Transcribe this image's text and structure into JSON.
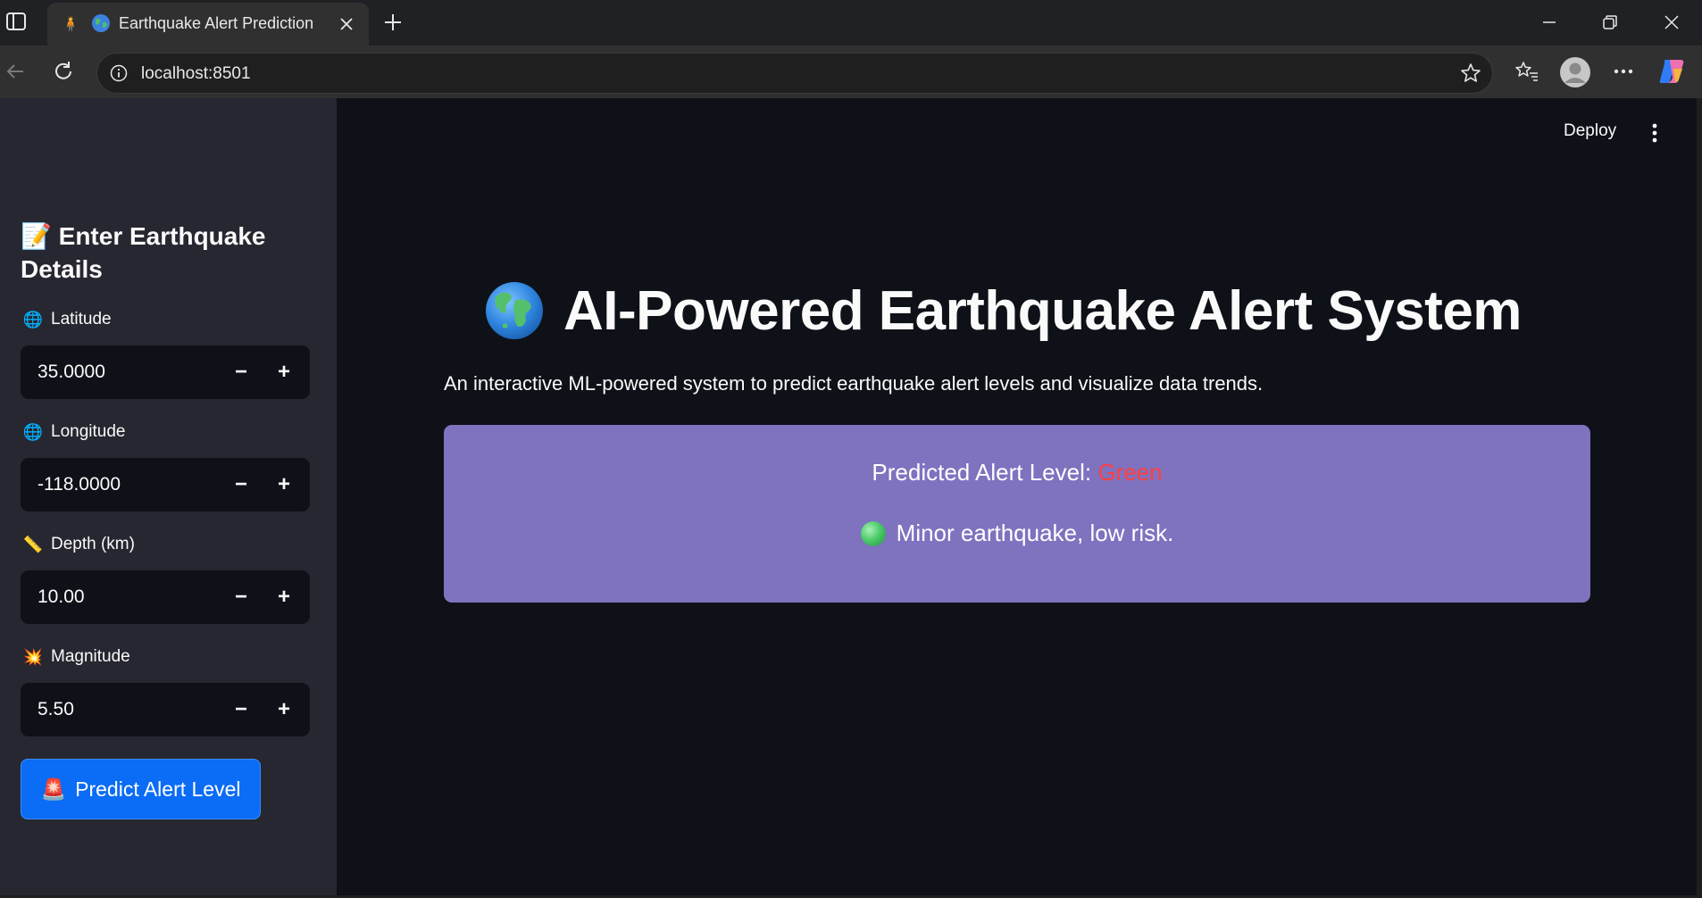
{
  "browser": {
    "tab_title": "Earthquake Alert Prediction",
    "url": "localhost:8501"
  },
  "header": {
    "deploy_label": "Deploy"
  },
  "sidebar": {
    "heading": "📝 Enter Earthquake Details",
    "fields": [
      {
        "icon": "🌐",
        "label": "Latitude",
        "value": "35.0000"
      },
      {
        "icon": "🌐",
        "label": "Longitude",
        "value": "-118.0000"
      },
      {
        "icon": "📏",
        "label": "Depth (km)",
        "value": "10.00"
      },
      {
        "icon": "💥",
        "label": "Magnitude",
        "value": "5.50"
      }
    ],
    "stepper": {
      "minus": "−",
      "plus": "+"
    },
    "predict_button": {
      "icon": "🚨",
      "label": "Predict Alert Level"
    }
  },
  "main": {
    "title": "AI-Powered Earthquake Alert System",
    "subtitle": "An interactive ML-powered system to predict earthquake alert levels and visualize data trends.",
    "result": {
      "prefix": "Predicted Alert Level: ",
      "level": "Green",
      "message": "Minor earthquake, low risk."
    }
  },
  "colors": {
    "app_bg": "#0e1117",
    "sidebar_bg": "#262730",
    "card_bg": "#7f72bf",
    "alert_text": "#ff4040",
    "primary_button": "#0b6cf5"
  }
}
